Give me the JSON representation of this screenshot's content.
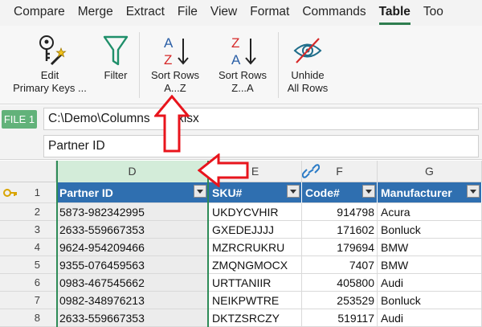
{
  "menu": {
    "items": [
      "Compare",
      "Merge",
      "Extract",
      "File",
      "View",
      "Format",
      "Commands",
      "Table",
      "Too"
    ],
    "active_index": 7
  },
  "ribbon": {
    "edit_keys": {
      "line1": "Edit",
      "line2": "Primary Keys ..."
    },
    "filter": {
      "line1": "Filter"
    },
    "sort_az": {
      "line1": "Sort Rows",
      "line2": "A...Z",
      "icon_top": "A",
      "icon_bottom": "Z"
    },
    "sort_za": {
      "line1": "Sort Rows",
      "line2": "Z...A",
      "icon_top": "Z",
      "icon_bottom": "A"
    },
    "unhide": {
      "line1": "Unhide",
      "line2": "All Rows"
    }
  },
  "path_bar": {
    "file_label": "FILE 1",
    "path": "C:\\Demo\\Columns     1.xlsx"
  },
  "cell_bar": {
    "value": "Partner ID"
  },
  "grid": {
    "columns": [
      "D",
      "E",
      "F",
      "G"
    ],
    "selected_column": "D",
    "headers": [
      "Partner ID",
      "SKU#",
      "Code#",
      "Manufacturer"
    ],
    "row_numbers": [
      "1",
      "2",
      "3",
      "4",
      "5",
      "6",
      "7",
      "8"
    ],
    "rows": [
      [
        "5873-982342995",
        "UKDYCVHIR",
        "914798",
        "Acura"
      ],
      [
        "2633-559667353",
        "GXEDEJJJJ",
        "171602",
        "Bonluck"
      ],
      [
        "9624-954209466",
        "MZRCRUKRU",
        "179694",
        "BMW"
      ],
      [
        "9355-076459563",
        "ZMQNGMOCX",
        "7407",
        "BMW"
      ],
      [
        "0983-467545662",
        "URTTANIIR",
        "405800",
        "Audi"
      ],
      [
        "0982-348976213",
        "NEIKPWTRE",
        "253529",
        "Bonluck"
      ],
      [
        "2633-559667353",
        "DKTZSRCZY",
        "519117",
        "Audi"
      ]
    ]
  },
  "colors": {
    "accent_green": "#2f7d4f",
    "file_badge": "#62b27a",
    "header_blue": "#2f6fb0",
    "annotation_red": "#e8141c"
  },
  "icons": {
    "edit_keys": "key-wand-icon",
    "filter": "funnel-icon",
    "sort_az": "sort-ascending-icon",
    "sort_za": "sort-descending-icon",
    "unhide": "eye-slash-icon",
    "link": "link-icon",
    "primary_key": "key-icon"
  }
}
